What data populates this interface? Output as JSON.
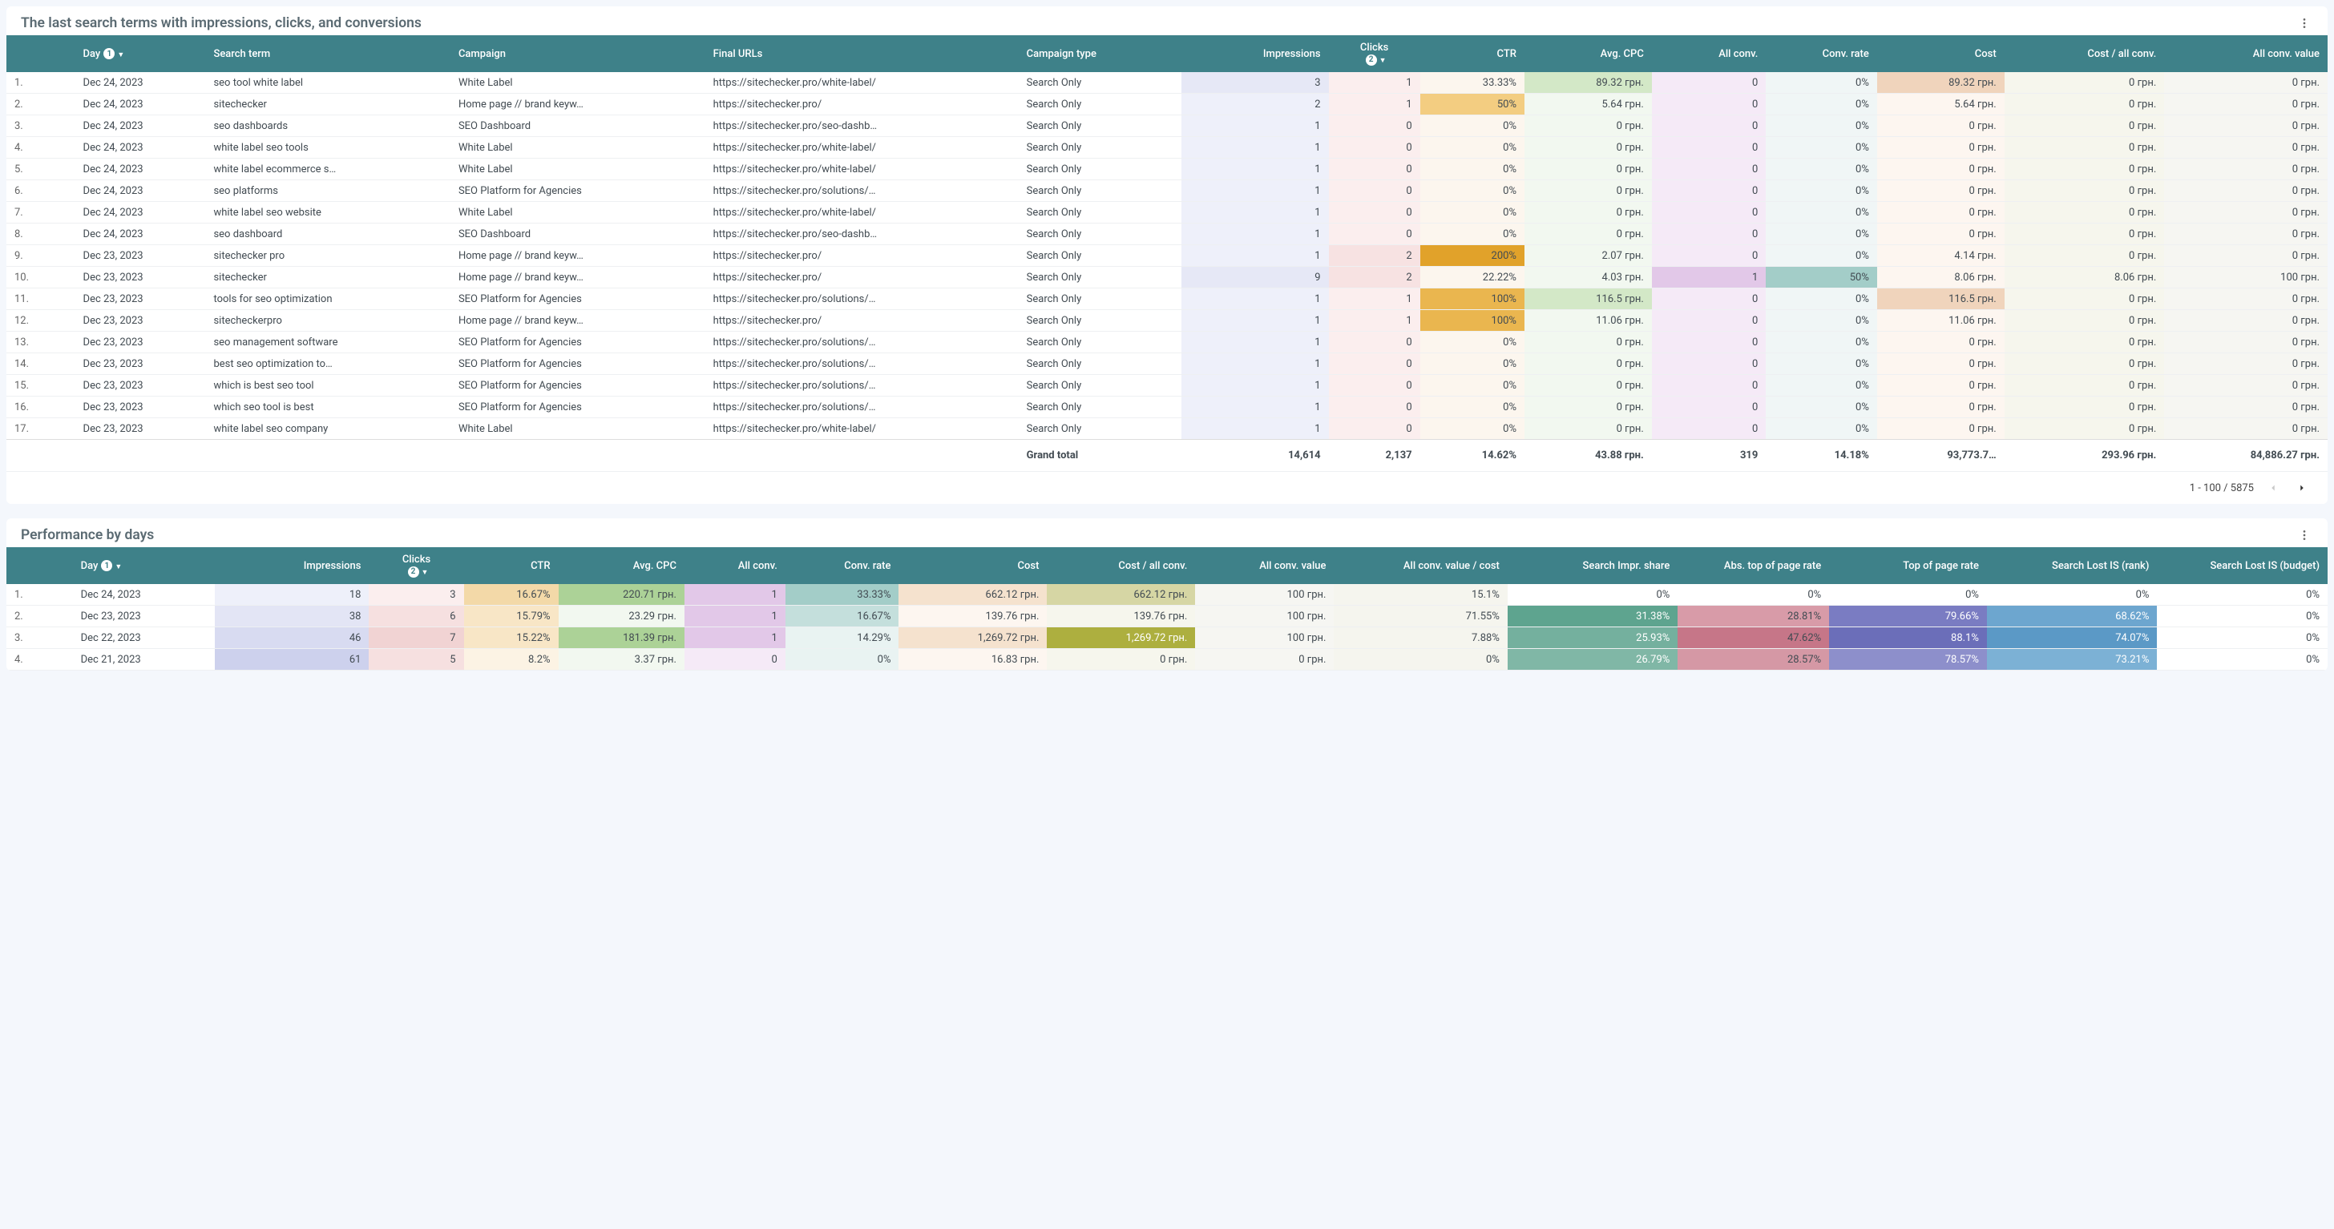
{
  "panel1": {
    "title": "The last search terms with impressions, clicks, and conversions",
    "headers": [
      "Day",
      "Search term",
      "Campaign",
      "Final URLs",
      "Campaign type",
      "Impressions",
      "Clicks",
      "CTR",
      "Avg. CPC",
      "All conv.",
      "Conv. rate",
      "Cost",
      "Cost / all conv.",
      "All conv. value"
    ],
    "rows": [
      {
        "i": "1.",
        "day": "Dec 24, 2023",
        "term": "seo tool white label",
        "camp": "White Label",
        "url": "https://sitechecker.pro/white-label/",
        "type": "Search Only",
        "impr": "3",
        "clicks": "1",
        "ctr": "33.33%",
        "cpc": "89.32 грн.",
        "allconv": "0",
        "cr": "0%",
        "cost": "89.32 грн.",
        "costconv": "0 грн.",
        "allval": "0 грн."
      },
      {
        "i": "2.",
        "day": "Dec 24, 2023",
        "term": "sitechecker",
        "camp": "Home page // brand keyw…",
        "url": "https://sitechecker.pro/",
        "type": "Search Only",
        "impr": "2",
        "clicks": "1",
        "ctr": "50%",
        "cpc": "5.64 грн.",
        "allconv": "0",
        "cr": "0%",
        "cost": "5.64 грн.",
        "costconv": "0 грн.",
        "allval": "0 грн."
      },
      {
        "i": "3.",
        "day": "Dec 24, 2023",
        "term": "seo dashboards",
        "camp": "SEO Dashboard",
        "url": "https://sitechecker.pro/seo-dashb…",
        "type": "Search Only",
        "impr": "1",
        "clicks": "0",
        "ctr": "0%",
        "cpc": "0 грн.",
        "allconv": "0",
        "cr": "0%",
        "cost": "0 грн.",
        "costconv": "0 грн.",
        "allval": "0 грн."
      },
      {
        "i": "4.",
        "day": "Dec 24, 2023",
        "term": "white label seo tools",
        "camp": "White Label",
        "url": "https://sitechecker.pro/white-label/",
        "type": "Search Only",
        "impr": "1",
        "clicks": "0",
        "ctr": "0%",
        "cpc": "0 грн.",
        "allconv": "0",
        "cr": "0%",
        "cost": "0 грн.",
        "costconv": "0 грн.",
        "allval": "0 грн."
      },
      {
        "i": "5.",
        "day": "Dec 24, 2023",
        "term": "white label ecommerce s…",
        "camp": "White Label",
        "url": "https://sitechecker.pro/white-label/",
        "type": "Search Only",
        "impr": "1",
        "clicks": "0",
        "ctr": "0%",
        "cpc": "0 грн.",
        "allconv": "0",
        "cr": "0%",
        "cost": "0 грн.",
        "costconv": "0 грн.",
        "allval": "0 грн."
      },
      {
        "i": "6.",
        "day": "Dec 24, 2023",
        "term": "seo platforms",
        "camp": "SEO Platform for Agencies",
        "url": "https://sitechecker.pro/solutions/…",
        "type": "Search Only",
        "impr": "1",
        "clicks": "0",
        "ctr": "0%",
        "cpc": "0 грн.",
        "allconv": "0",
        "cr": "0%",
        "cost": "0 грн.",
        "costconv": "0 грн.",
        "allval": "0 грн."
      },
      {
        "i": "7.",
        "day": "Dec 24, 2023",
        "term": "white label seo website",
        "camp": "White Label",
        "url": "https://sitechecker.pro/white-label/",
        "type": "Search Only",
        "impr": "1",
        "clicks": "0",
        "ctr": "0%",
        "cpc": "0 грн.",
        "allconv": "0",
        "cr": "0%",
        "cost": "0 грн.",
        "costconv": "0 грн.",
        "allval": "0 грн."
      },
      {
        "i": "8.",
        "day": "Dec 24, 2023",
        "term": "seo dashboard",
        "camp": "SEO Dashboard",
        "url": "https://sitechecker.pro/seo-dashb…",
        "type": "Search Only",
        "impr": "1",
        "clicks": "0",
        "ctr": "0%",
        "cpc": "0 грн.",
        "allconv": "0",
        "cr": "0%",
        "cost": "0 грн.",
        "costconv": "0 грн.",
        "allval": "0 грн."
      },
      {
        "i": "9.",
        "day": "Dec 23, 2023",
        "term": "sitechecker pro",
        "camp": "Home page // brand keyw…",
        "url": "https://sitechecker.pro/",
        "type": "Search Only",
        "impr": "1",
        "clicks": "2",
        "ctr": "200%",
        "cpc": "2.07 грн.",
        "allconv": "0",
        "cr": "0%",
        "cost": "4.14 грн.",
        "costconv": "0 грн.",
        "allval": "0 грн."
      },
      {
        "i": "10.",
        "day": "Dec 23, 2023",
        "term": "sitechecker",
        "camp": "Home page // brand keyw…",
        "url": "https://sitechecker.pro/",
        "type": "Search Only",
        "impr": "9",
        "clicks": "2",
        "ctr": "22.22%",
        "cpc": "4.03 грн.",
        "allconv": "1",
        "cr": "50%",
        "cost": "8.06 грн.",
        "costconv": "8.06 грн.",
        "allval": "100 грн."
      },
      {
        "i": "11.",
        "day": "Dec 23, 2023",
        "term": "tools for seo optimization",
        "camp": "SEO Platform for Agencies",
        "url": "https://sitechecker.pro/solutions/…",
        "type": "Search Only",
        "impr": "1",
        "clicks": "1",
        "ctr": "100%",
        "cpc": "116.5 грн.",
        "allconv": "0",
        "cr": "0%",
        "cost": "116.5 грн.",
        "costconv": "0 грн.",
        "allval": "0 грн."
      },
      {
        "i": "12.",
        "day": "Dec 23, 2023",
        "term": "sitecheckerpro",
        "camp": "Home page // brand keyw…",
        "url": "https://sitechecker.pro/",
        "type": "Search Only",
        "impr": "1",
        "clicks": "1",
        "ctr": "100%",
        "cpc": "11.06 грн.",
        "allconv": "0",
        "cr": "0%",
        "cost": "11.06 грн.",
        "costconv": "0 грн.",
        "allval": "0 грн."
      },
      {
        "i": "13.",
        "day": "Dec 23, 2023",
        "term": "seo management software",
        "camp": "SEO Platform for Agencies",
        "url": "https://sitechecker.pro/solutions/…",
        "type": "Search Only",
        "impr": "1",
        "clicks": "0",
        "ctr": "0%",
        "cpc": "0 грн.",
        "allconv": "0",
        "cr": "0%",
        "cost": "0 грн.",
        "costconv": "0 грн.",
        "allval": "0 грн."
      },
      {
        "i": "14.",
        "day": "Dec 23, 2023",
        "term": "best seo optimization to…",
        "camp": "SEO Platform for Agencies",
        "url": "https://sitechecker.pro/solutions/…",
        "type": "Search Only",
        "impr": "1",
        "clicks": "0",
        "ctr": "0%",
        "cpc": "0 грн.",
        "allconv": "0",
        "cr": "0%",
        "cost": "0 грн.",
        "costconv": "0 грн.",
        "allval": "0 грн."
      },
      {
        "i": "15.",
        "day": "Dec 23, 2023",
        "term": "which is best seo tool",
        "camp": "SEO Platform for Agencies",
        "url": "https://sitechecker.pro/solutions/…",
        "type": "Search Only",
        "impr": "1",
        "clicks": "0",
        "ctr": "0%",
        "cpc": "0 грн.",
        "allconv": "0",
        "cr": "0%",
        "cost": "0 грн.",
        "costconv": "0 грн.",
        "allval": "0 грн."
      },
      {
        "i": "16.",
        "day": "Dec 23, 2023",
        "term": "which seo tool is best",
        "camp": "SEO Platform for Agencies",
        "url": "https://sitechecker.pro/solutions/…",
        "type": "Search Only",
        "impr": "1",
        "clicks": "0",
        "ctr": "0%",
        "cpc": "0 грн.",
        "allconv": "0",
        "cr": "0%",
        "cost": "0 грн.",
        "costconv": "0 грн.",
        "allval": "0 грн."
      },
      {
        "i": "17.",
        "day": "Dec 23, 2023",
        "term": "white label seo company",
        "camp": "White Label",
        "url": "https://sitechecker.pro/white-label/",
        "type": "Search Only",
        "impr": "1",
        "clicks": "0",
        "ctr": "0%",
        "cpc": "0 грн.",
        "allconv": "0",
        "cr": "0%",
        "cost": "0 грн.",
        "costconv": "0 грн.",
        "allval": "0 грн."
      }
    ],
    "total": {
      "label": "Grand total",
      "impr": "14,614",
      "clicks": "2,137",
      "ctr": "14.62%",
      "cpc": "43.88 грн.",
      "allconv": "319",
      "cr": "14.18%",
      "cost": "93,773.7…",
      "costconv": "293.96 грн.",
      "allval": "84,886.27 грн."
    },
    "pager": "1 - 100 / 5875"
  },
  "panel2": {
    "title": "Performance by days",
    "headers": [
      "Day",
      "Impressions",
      "Clicks",
      "CTR",
      "Avg. CPC",
      "All conv.",
      "Conv. rate",
      "Cost",
      "Cost / all conv.",
      "All conv. value",
      "All conv. value / cost",
      "Search Impr. share",
      "Abs. top of page rate",
      "Top of page rate",
      "Search Lost IS (rank)",
      "Search Lost IS (budget)"
    ],
    "rows": [
      {
        "i": "1.",
        "day": "Dec 24, 2023",
        "impr": "18",
        "clicks": "3",
        "ctr": "16.67%",
        "cpc": "220.71 грн.",
        "allconv": "1",
        "cr": "33.33%",
        "cost": "662.12 грн.",
        "costc": "662.12 грн.",
        "acv": "100 грн.",
        "acvc": "15.1%",
        "sis": "0%",
        "abs": "0%",
        "top": "0%",
        "rank": "0%",
        "budget": "0%"
      },
      {
        "i": "2.",
        "day": "Dec 23, 2023",
        "impr": "38",
        "clicks": "6",
        "ctr": "15.79%",
        "cpc": "23.29 грн.",
        "allconv": "1",
        "cr": "16.67%",
        "cost": "139.76 грн.",
        "costc": "139.76 грн.",
        "acv": "100 грн.",
        "acvc": "71.55%",
        "sis": "31.38%",
        "abs": "28.81%",
        "top": "79.66%",
        "rank": "68.62%",
        "budget": "0%"
      },
      {
        "i": "3.",
        "day": "Dec 22, 2023",
        "impr": "46",
        "clicks": "7",
        "ctr": "15.22%",
        "cpc": "181.39 грн.",
        "allconv": "1",
        "cr": "14.29%",
        "cost": "1,269.72 грн.",
        "costc": "1,269.72 грн.",
        "acv": "100 грн.",
        "acvc": "7.88%",
        "sis": "25.93%",
        "abs": "47.62%",
        "top": "88.1%",
        "rank": "74.07%",
        "budget": "0%"
      },
      {
        "i": "4.",
        "day": "Dec 21, 2023",
        "impr": "61",
        "clicks": "5",
        "ctr": "8.2%",
        "cpc": "3.37 грн.",
        "allconv": "0",
        "cr": "0%",
        "cost": "16.83 грн.",
        "costc": "0 грн.",
        "acv": "0 грн.",
        "acvc": "0%",
        "sis": "26.79%",
        "abs": "28.57%",
        "top": "78.57%",
        "rank": "73.21%",
        "budget": "0%"
      }
    ]
  }
}
